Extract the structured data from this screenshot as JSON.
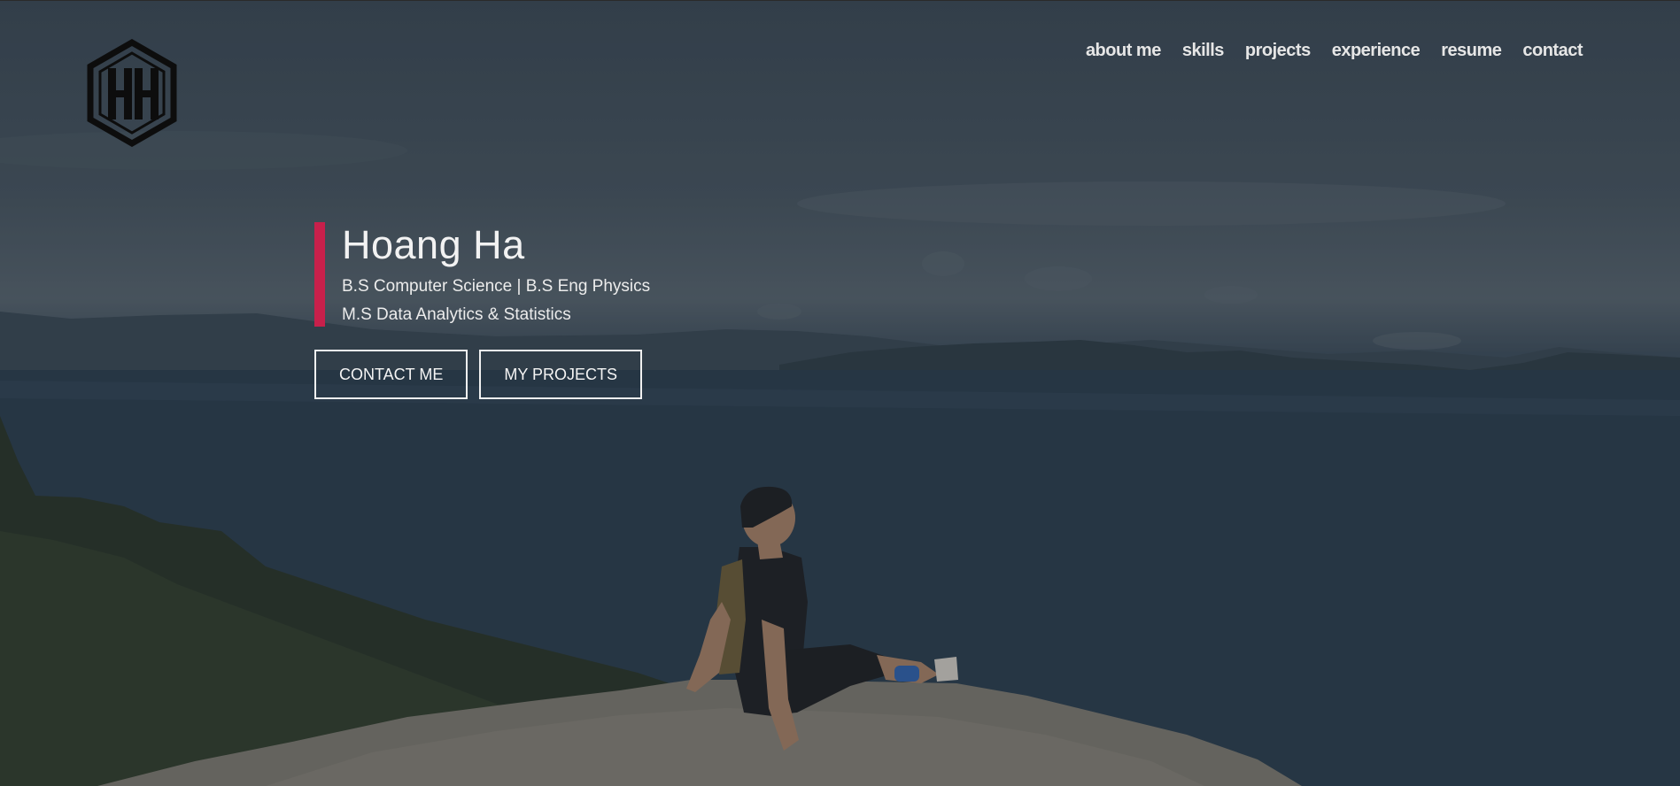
{
  "brand": {
    "logo_letters": "HH"
  },
  "nav": {
    "items": [
      {
        "label": "about me"
      },
      {
        "label": "skills"
      },
      {
        "label": "projects"
      },
      {
        "label": "experience"
      },
      {
        "label": "resume"
      },
      {
        "label": "contact"
      }
    ]
  },
  "hero": {
    "name": "Hoang Ha",
    "line1": "B.S Computer Science | B.S Eng Physics",
    "line2": "M.S Data Analytics & Statistics",
    "accent_color": "#c8204b",
    "buttons": {
      "contact_label": "CONTACT ME",
      "projects_label": "MY PROJECTS"
    }
  }
}
